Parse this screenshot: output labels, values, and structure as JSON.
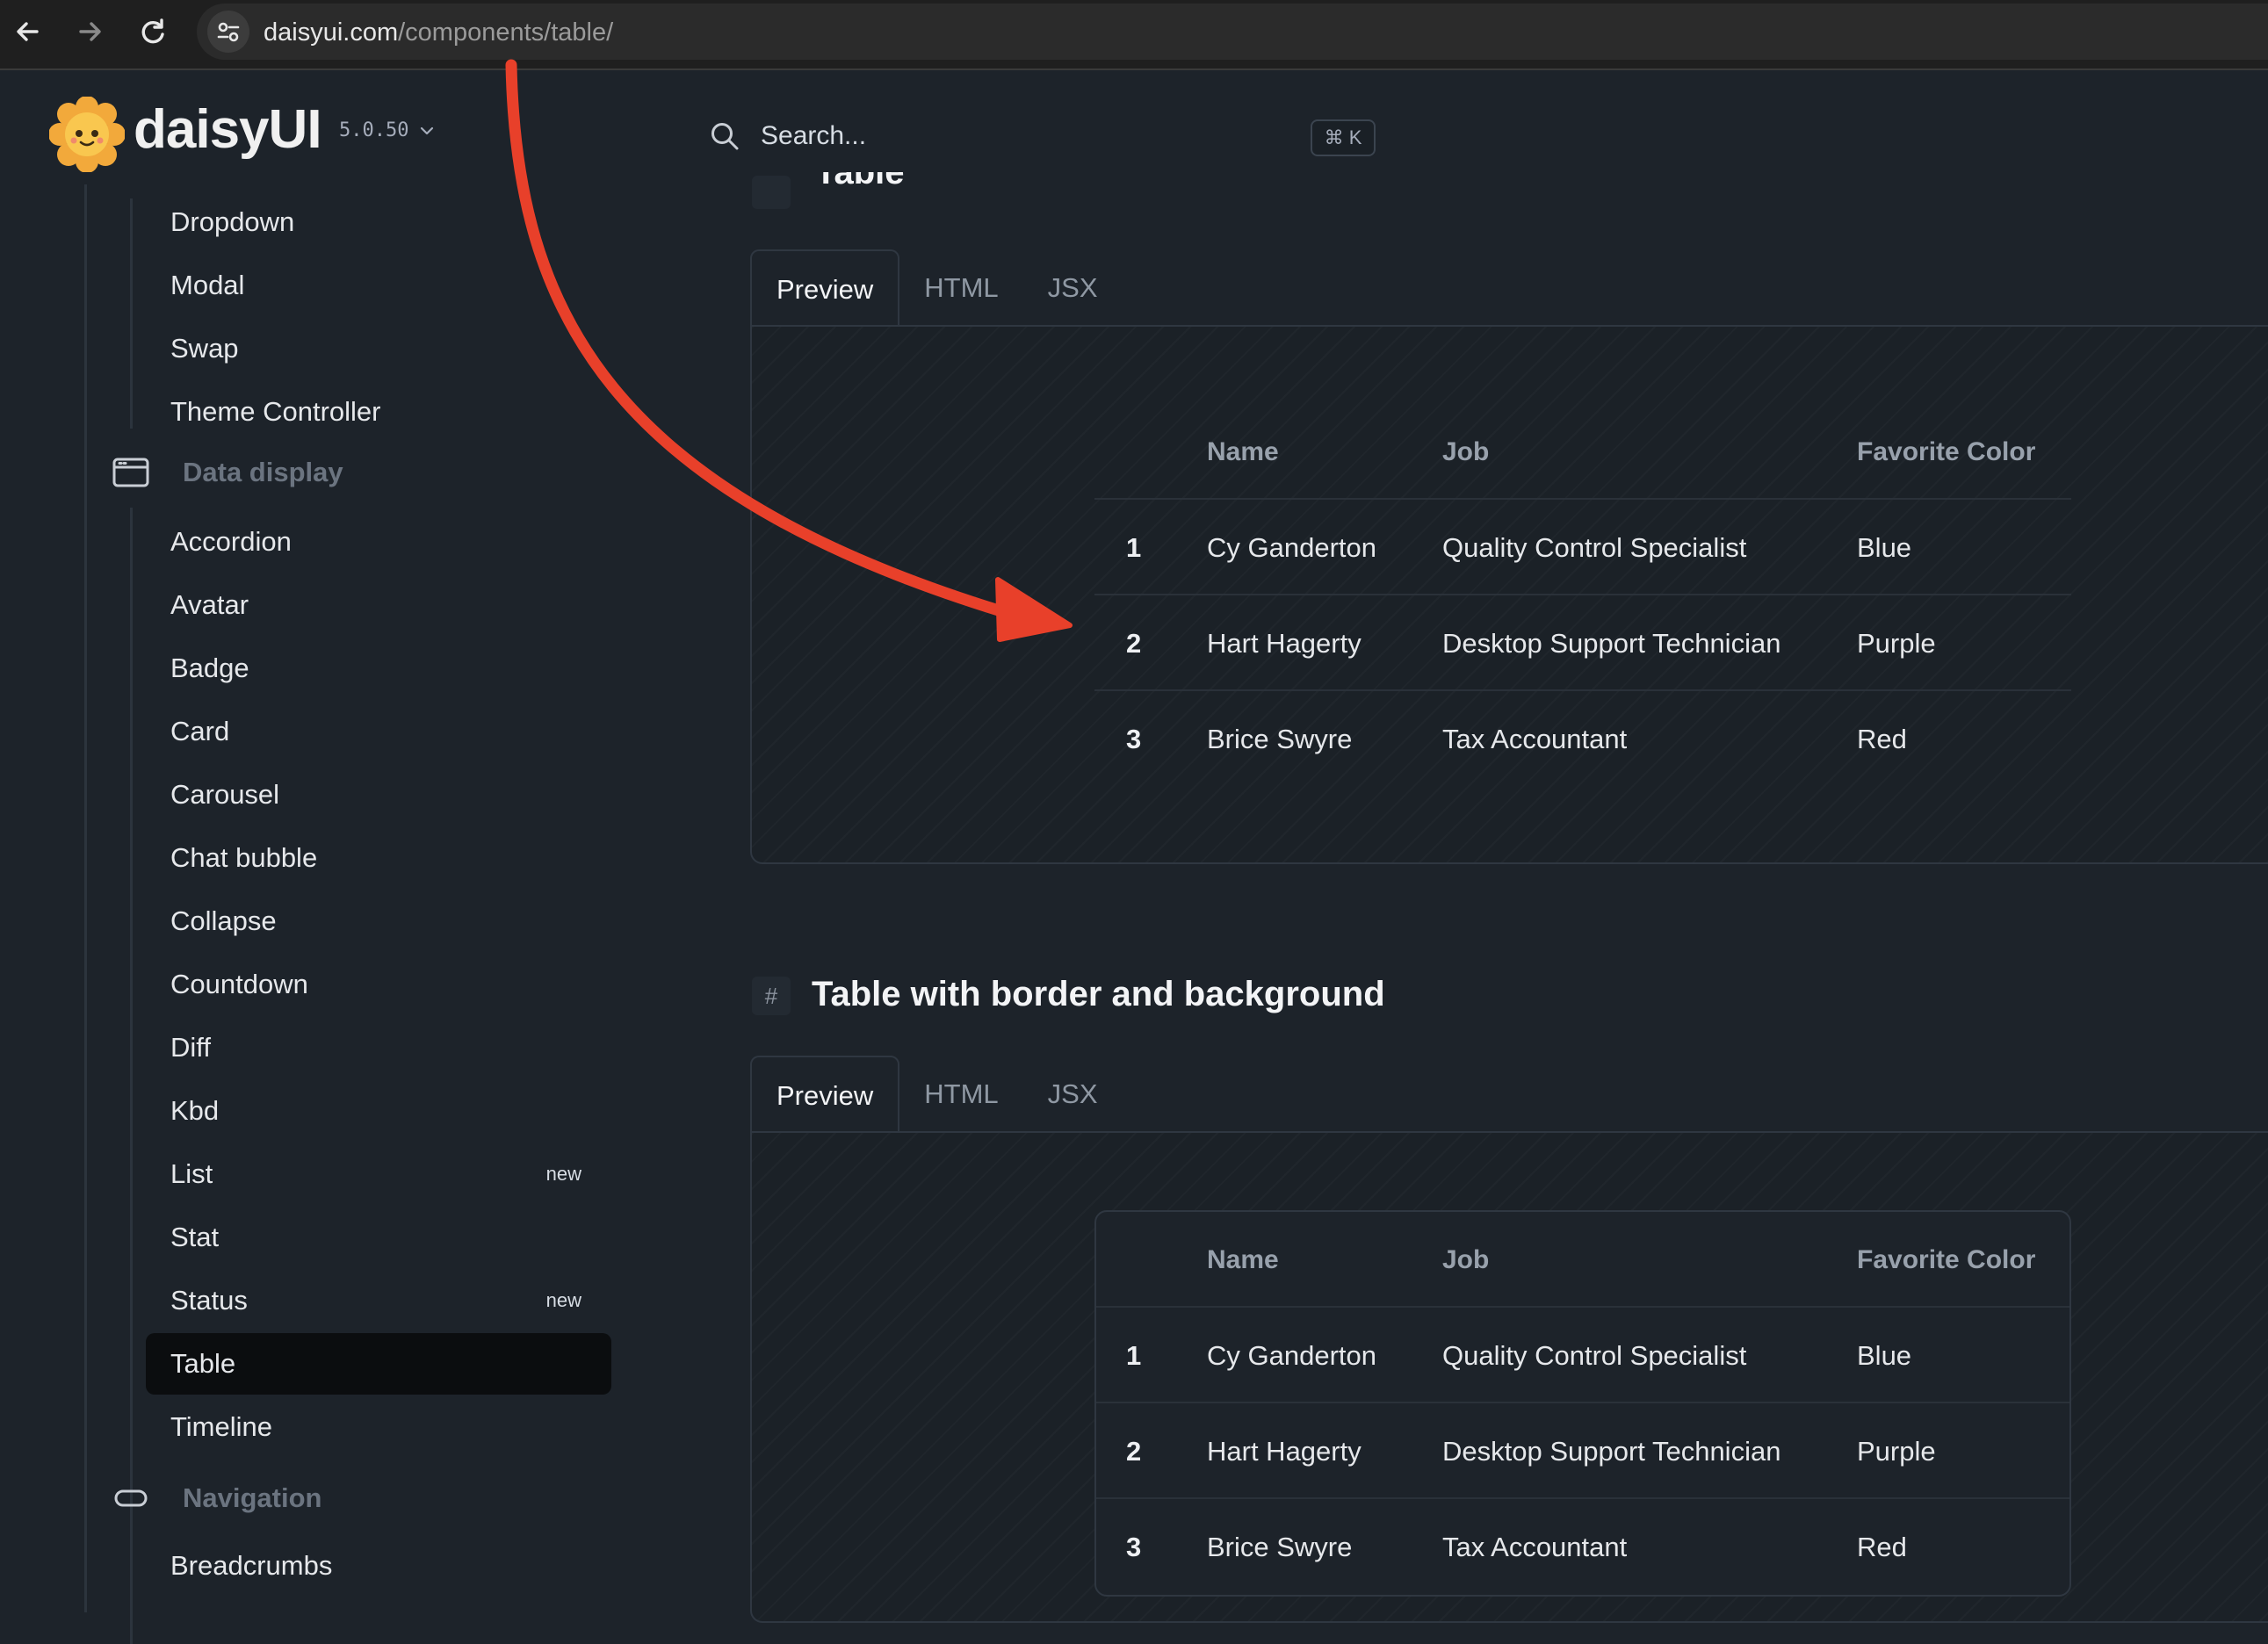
{
  "browser": {
    "url_host": "daisyui.com",
    "url_path": "/components/table/"
  },
  "header": {
    "brand": "daisyUI",
    "version": "5.0.50",
    "search_placeholder": "Search...",
    "shortcut": "⌘ K"
  },
  "sidebar": {
    "top_items": [
      "Dropdown",
      "Modal",
      "Swap",
      "Theme Controller"
    ],
    "data_display_label": "Data display",
    "data_display_items": [
      {
        "label": "Accordion",
        "badge": ""
      },
      {
        "label": "Avatar",
        "badge": ""
      },
      {
        "label": "Badge",
        "badge": ""
      },
      {
        "label": "Card",
        "badge": ""
      },
      {
        "label": "Carousel",
        "badge": ""
      },
      {
        "label": "Chat bubble",
        "badge": ""
      },
      {
        "label": "Collapse",
        "badge": ""
      },
      {
        "label": "Countdown",
        "badge": ""
      },
      {
        "label": "Diff",
        "badge": ""
      },
      {
        "label": "Kbd",
        "badge": ""
      },
      {
        "label": "List",
        "badge": "new"
      },
      {
        "label": "Stat",
        "badge": ""
      },
      {
        "label": "Status",
        "badge": "new"
      },
      {
        "label": "Table",
        "badge": "",
        "active": true
      },
      {
        "label": "Timeline",
        "badge": ""
      }
    ],
    "navigation_label": "Navigation",
    "navigation_items": [
      "Breadcrumbs"
    ]
  },
  "main": {
    "section1_title": "Table",
    "section2_title": "Table with border and background",
    "tabs": [
      "Preview",
      "HTML",
      "JSX"
    ],
    "table": {
      "headers": [
        "",
        "Name",
        "Job",
        "Favorite Color"
      ],
      "rows": [
        [
          "1",
          "Cy Ganderton",
          "Quality Control Specialist",
          "Blue"
        ],
        [
          "2",
          "Hart Hagerty",
          "Desktop Support Technician",
          "Purple"
        ],
        [
          "3",
          "Brice Swyre",
          "Tax Accountant",
          "Red"
        ]
      ]
    }
  },
  "annotation": {
    "arrow_color": "#e8402a"
  }
}
